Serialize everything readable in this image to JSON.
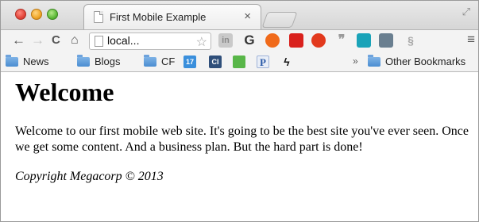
{
  "tab": {
    "title": "First Mobile Example",
    "close": "×"
  },
  "toolbar": {
    "back": "←",
    "forward": "→",
    "reload": "C",
    "home": "⌂",
    "url": "local...",
    "star": "☆",
    "menu": "≡"
  },
  "extensions": {
    "linkedin": "in",
    "g": "G",
    "quote": "❞",
    "coil": "§"
  },
  "bookmarks": {
    "items": [
      {
        "label": "News",
        "icon": "folder-icon"
      },
      {
        "label": "Blogs",
        "icon": "folder-icon"
      },
      {
        "label": "CF",
        "icon": "folder-icon"
      }
    ],
    "calendar": "17",
    "cl": "CI",
    "p": "P",
    "bolt": "ϟ",
    "more": "»",
    "other": "Other Bookmarks"
  },
  "page": {
    "heading": "Welcome",
    "paragraph": "Welcome to our first mobile web site. It's going to be the best site you've ever seen. Once we get some content. And a business plan. But the hard part is done!",
    "copyright": "Copyright Megacorp © 2013"
  },
  "colors": {
    "tab_strip": "#d6d6d6",
    "toolbar": "#f3f3f3",
    "folder": "#4a8dd1"
  }
}
